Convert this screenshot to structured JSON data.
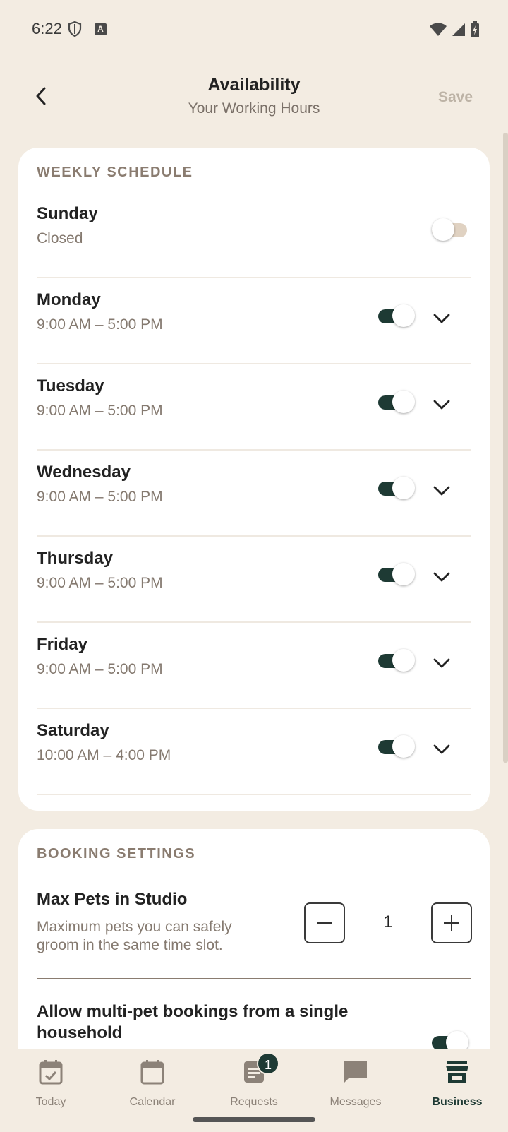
{
  "status_bar": {
    "time": "6:22"
  },
  "header": {
    "title": "Availability",
    "subtitle": "Your Working Hours",
    "save_label": "Save"
  },
  "weekly": {
    "label": "WEEKLY SCHEDULE",
    "days": [
      {
        "name": "Sunday",
        "hours": "Closed",
        "enabled": false
      },
      {
        "name": "Monday",
        "hours": "9:00 AM – 5:00 PM",
        "enabled": true
      },
      {
        "name": "Tuesday",
        "hours": "9:00 AM – 5:00 PM",
        "enabled": true
      },
      {
        "name": "Wednesday",
        "hours": "9:00 AM – 5:00 PM",
        "enabled": true
      },
      {
        "name": "Thursday",
        "hours": "9:00 AM – 5:00 PM",
        "enabled": true
      },
      {
        "name": "Friday",
        "hours": "9:00 AM – 5:00 PM",
        "enabled": true
      },
      {
        "name": "Saturday",
        "hours": "10:00 AM – 4:00 PM",
        "enabled": true
      }
    ]
  },
  "booking": {
    "label": "BOOKING SETTINGS",
    "max_pets": {
      "title": "Max Pets in Studio",
      "description": "Maximum pets you can safely groom in the same time slot.",
      "value": "1"
    },
    "multi_pet": {
      "title": "Allow multi-pet bookings from a single household",
      "enabled": true
    }
  },
  "nav": {
    "items": [
      {
        "label": "Today",
        "icon": "calendar-check-icon"
      },
      {
        "label": "Calendar",
        "icon": "calendar-icon"
      },
      {
        "label": "Requests",
        "icon": "requests-icon",
        "badge": "1"
      },
      {
        "label": "Messages",
        "icon": "message-icon"
      },
      {
        "label": "Business",
        "icon": "storefront-icon",
        "active": true
      }
    ]
  },
  "colors": {
    "background": "#f3ece2",
    "accent": "#1e3a34",
    "muted_text": "#857a70",
    "toggle_off_track": "#e0d2c2"
  }
}
